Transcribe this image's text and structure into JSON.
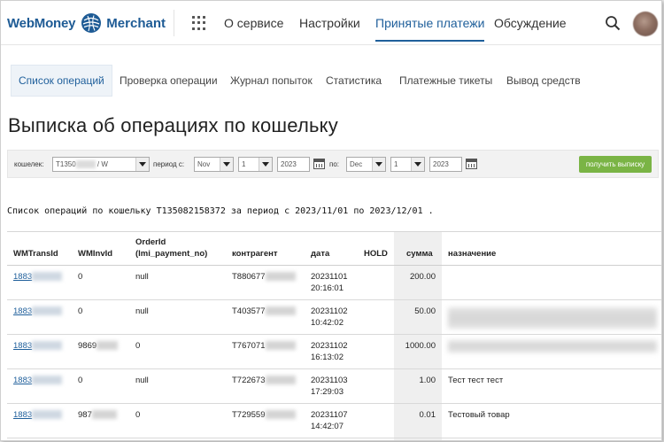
{
  "header": {
    "logo_left": "WebMoney",
    "logo_right": "Merchant",
    "nav": [
      "О сервисе",
      "Настройки",
      "Принятые платежи",
      "Обсуждение"
    ],
    "active_nav": "Принятые платежи"
  },
  "subtabs": [
    "Список операций",
    "Проверка операции",
    "Журнал попыток",
    "Статистика",
    "Платежные тикеты",
    "Вывод средств"
  ],
  "page_title": "Выписка об операциях по кошельку",
  "filter": {
    "wallet_label": "кошелек:",
    "wallet_value": "T1350",
    "wallet_suffix": " / W",
    "period_label": "период с:",
    "from_month": "Nov",
    "from_day": "1",
    "from_year": "2023",
    "to_label": "по:",
    "to_month": "Dec",
    "to_day": "1",
    "to_year": "2023",
    "submit": "получить выписку"
  },
  "summary_text": "Список операций по кошельку T135082158372 за период с 2023/11/01 по 2023/12/01 .",
  "table": {
    "headers": {
      "wmtransid": "WMTransId",
      "wminvid": "WMInvId",
      "orderid_1": "OrderId",
      "orderid_2": "(lmi_payment_no)",
      "counterparty": "контрагент",
      "date": "дата",
      "hold": "HOLD",
      "amount": "сумма",
      "purpose": "назначение"
    },
    "rows": [
      {
        "trans": "1883",
        "inv": "0",
        "order": "null",
        "party": "T880677",
        "date": "20231101",
        "time": "20:16:01",
        "amount": "200.00",
        "purpose": ""
      },
      {
        "trans": "1883",
        "inv": "0",
        "order": "null",
        "party": "T403577",
        "date": "20231102",
        "time": "10:42:02",
        "amount": "50.00",
        "purpose": ""
      },
      {
        "trans": "1883",
        "inv": "9869",
        "order": "0",
        "party": "T767071",
        "date": "20231102",
        "time": "16:13:02",
        "amount": "1000.00",
        "purpose": ""
      },
      {
        "trans": "1883",
        "inv": "0",
        "order": "null",
        "party": "T722673",
        "date": "20231103",
        "time": "17:29:03",
        "amount": "1.00",
        "purpose": "Тест тест тест"
      },
      {
        "trans": "1883",
        "inv": "987",
        "order": "0",
        "party": "T729559",
        "date": "20231107",
        "time": "14:42:07",
        "amount": "0.01",
        "purpose": "Тестовый товар"
      }
    ]
  },
  "colors": {
    "brand": "#1e5b95",
    "accent_green": "#7ab445",
    "link": "#1f5f9b"
  },
  "icons": [
    "globe-logo-icon",
    "apps-grid-icon",
    "search-icon",
    "calendar-icon",
    "chevron-down-icon"
  ]
}
